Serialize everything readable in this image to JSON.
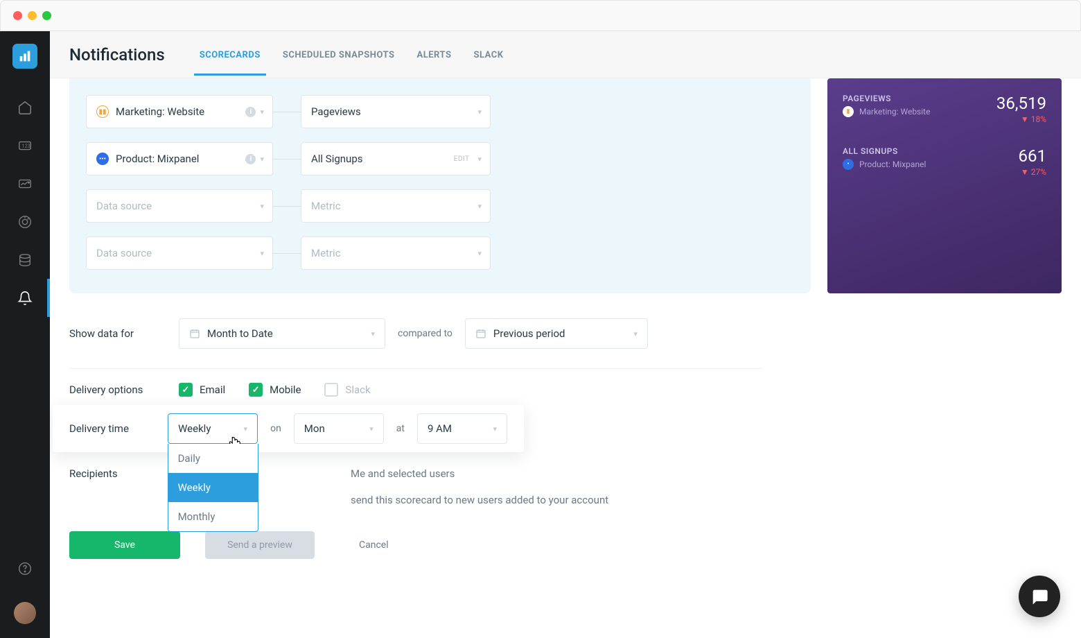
{
  "header": {
    "title": "Notifications",
    "tabs": [
      {
        "label": "SCORECARDS",
        "active": true
      },
      {
        "label": "SCHEDULED SNAPSHOTS",
        "active": false
      },
      {
        "label": "ALERTS",
        "active": false
      },
      {
        "label": "SLACK",
        "active": false
      }
    ]
  },
  "sources": {
    "row1": {
      "source": "Marketing: Website",
      "metric": "Pageviews"
    },
    "row2": {
      "source": "Product: Mixpanel",
      "metric": "All Signups",
      "edit": "EDIT"
    },
    "placeholder_source": "Data source",
    "placeholder_metric": "Metric"
  },
  "preview": {
    "metric1": {
      "title": "PAGEVIEWS",
      "source": "Marketing: Website",
      "value": "36,519",
      "change": "▼ 18%"
    },
    "metric2": {
      "title": "ALL SIGNUPS",
      "source": "Product: Mixpanel",
      "value": "661",
      "change": "▼ 27%"
    }
  },
  "show_data": {
    "label": "Show data for",
    "period": "Month to Date",
    "compared_label": "compared to",
    "compared": "Previous period"
  },
  "delivery_options": {
    "label": "Delivery options",
    "email": "Email",
    "mobile": "Mobile",
    "slack": "Slack"
  },
  "delivery_time": {
    "label": "Delivery time",
    "frequency": "Weekly",
    "on_label": "on",
    "day": "Mon",
    "at_label": "at",
    "time": "9 AM",
    "options": {
      "daily": "Daily",
      "weekly": "Weekly",
      "monthly": "Monthly"
    }
  },
  "recipients": {
    "label": "Recipients",
    "who": "Me and selected users",
    "auto": "send this scorecard to new users added to your account"
  },
  "buttons": {
    "save": "Save",
    "preview": "Send a preview",
    "cancel": "Cancel"
  }
}
